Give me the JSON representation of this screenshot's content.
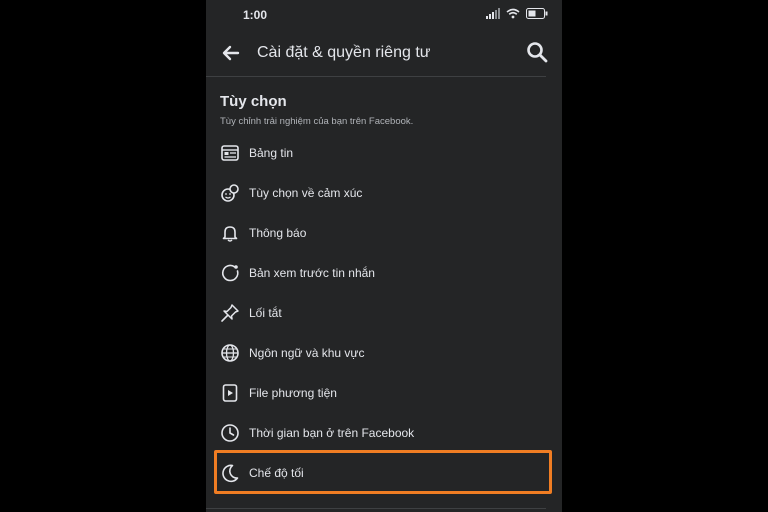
{
  "status_bar": {
    "time": "1:00"
  },
  "header": {
    "title": "Cài đặt & quyền riêng tư"
  },
  "section": {
    "title": "Tùy chọn",
    "subtitle": "Tùy chỉnh trải nghiệm của bạn trên Facebook."
  },
  "menu": {
    "items": [
      {
        "label": "Bảng tin",
        "icon": "news-feed-icon"
      },
      {
        "label": "Tùy chọn về cảm xúc",
        "icon": "reactions-icon"
      },
      {
        "label": "Thông báo",
        "icon": "bell-icon"
      },
      {
        "label": "Bản xem trước tin nhắn",
        "icon": "message-preview-icon"
      },
      {
        "label": "Lối tắt",
        "icon": "pin-icon"
      },
      {
        "label": "Ngôn ngữ và khu vực",
        "icon": "globe-icon"
      },
      {
        "label": "File phương tiện",
        "icon": "media-icon"
      },
      {
        "label": "Thời gian bạn ở trên Facebook",
        "icon": "clock-icon"
      },
      {
        "label": "Chế độ tối",
        "icon": "moon-icon"
      }
    ]
  },
  "colors": {
    "background": "#242526",
    "text": "#e4e6eb",
    "subtext": "#b0b3b8",
    "highlight": "#f07d23"
  }
}
